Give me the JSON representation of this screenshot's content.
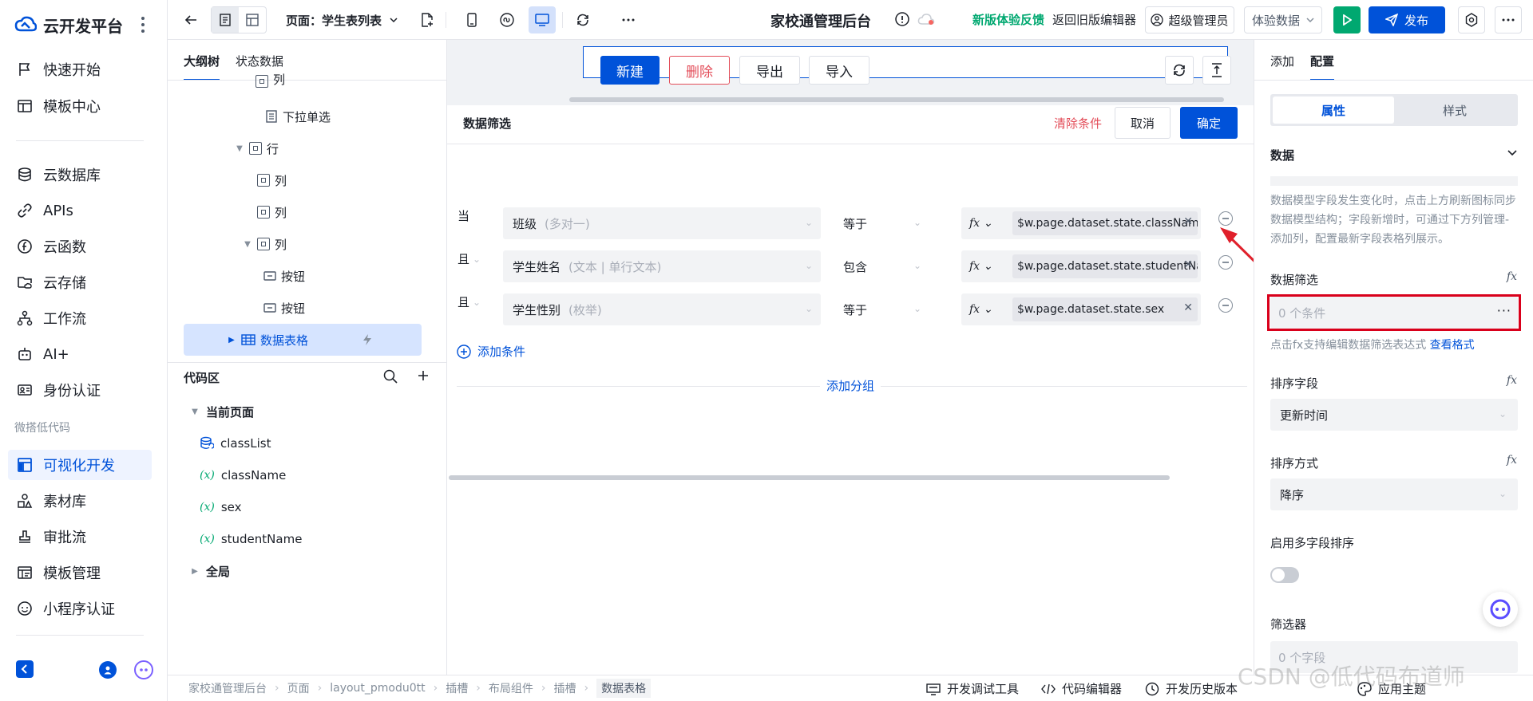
{
  "brand": {
    "name": "云开发平台"
  },
  "nav": {
    "items": [
      {
        "label": "快速开始"
      },
      {
        "label": "模板中心"
      },
      {
        "label": "云数据库"
      },
      {
        "label": "APIs"
      },
      {
        "label": "云函数"
      },
      {
        "label": "云存储"
      },
      {
        "label": "工作流"
      },
      {
        "label": "AI+"
      },
      {
        "label": "身份认证"
      }
    ],
    "group_label": "微搭低代码",
    "lowcode_items": [
      {
        "label": "可视化开发"
      },
      {
        "label": "素材库"
      },
      {
        "label": "审批流"
      },
      {
        "label": "模板管理"
      },
      {
        "label": "小程序认证"
      }
    ]
  },
  "topbar": {
    "page_select": "页面：学生表列表",
    "app_title": "家校通管理后台",
    "feedback": "新版体验反馈",
    "back_old": "返回旧版编辑器",
    "admin": "超级管理员",
    "data_select": "体验数据",
    "publish": "发布"
  },
  "outline": {
    "tabs": [
      "大纲树",
      "状态数据"
    ],
    "tree": [
      {
        "label": "列"
      },
      {
        "label": "下拉单选"
      },
      {
        "label": "行"
      },
      {
        "label": "列"
      },
      {
        "label": "列"
      },
      {
        "label": "列"
      },
      {
        "label": "按钮"
      },
      {
        "label": "按钮"
      },
      {
        "label": "数据表格"
      }
    ],
    "code_title": "代码区",
    "code_current": "当前页面",
    "code_items": [
      {
        "label": "classList"
      },
      {
        "label": "className"
      },
      {
        "label": "sex"
      },
      {
        "label": "studentName"
      }
    ],
    "code_global": "全局"
  },
  "canvas": {
    "toolbar_buttons": [
      "新建",
      "删除",
      "导出",
      "导入"
    ],
    "filter_title": "数据筛选",
    "clear": "清除条件",
    "cancel": "取消",
    "confirm": "确定",
    "conditions": [
      {
        "prefix": "当",
        "field": "班级",
        "field_type": "(多对一)",
        "op": "等于",
        "expr": "$w.page.dataset.state.className"
      },
      {
        "prefix": "且",
        "field": "学生姓名",
        "field_type": "(文本 | 单行文本)",
        "op": "包含",
        "expr": "$w.page.dataset.state.studentName"
      },
      {
        "prefix": "且",
        "field": "学生性别",
        "field_type": "(枚举)",
        "op": "等于",
        "expr": "$w.page.dataset.state.sex"
      }
    ],
    "add_condition": "添加条件",
    "add_group": "添加分组"
  },
  "right_panel": {
    "tabs": [
      "添加",
      "配置"
    ],
    "seg": [
      "属性",
      "样式"
    ],
    "section": "数据",
    "hint": "数据模型字段发生变化时，点击上方刷新图标同步数据模型结构；字段新增时，可通过下方列管理-添加列，配置最新字段表格列展示。",
    "filter_label": "数据筛选",
    "filter_value": "0 个条件",
    "filter_tip": "点击fx支持编辑数据筛选表达式",
    "filter_link": "查看格式",
    "sort_field_label": "排序字段",
    "sort_field_value": "更新时间",
    "sort_order_label": "排序方式",
    "sort_order_value": "降序",
    "multi_sort_label": "启用多字段排序",
    "filterer_label": "筛选器",
    "filterer_value": "0 个字段"
  },
  "bottom": {
    "crumbs": [
      "家校通管理后台",
      "页面",
      "layout_pmodu0tt",
      "插槽",
      "布局组件",
      "插槽",
      "数据表格"
    ],
    "tools": [
      "开发调试工具",
      "代码编辑器",
      "开发历史版本",
      "应用主题"
    ]
  },
  "watermark": "CSDN @低代码布道师",
  "colors": {
    "primary": "#0052d9",
    "danger": "#e34d59",
    "success": "#00a870",
    "highlight": "#d9001b"
  }
}
